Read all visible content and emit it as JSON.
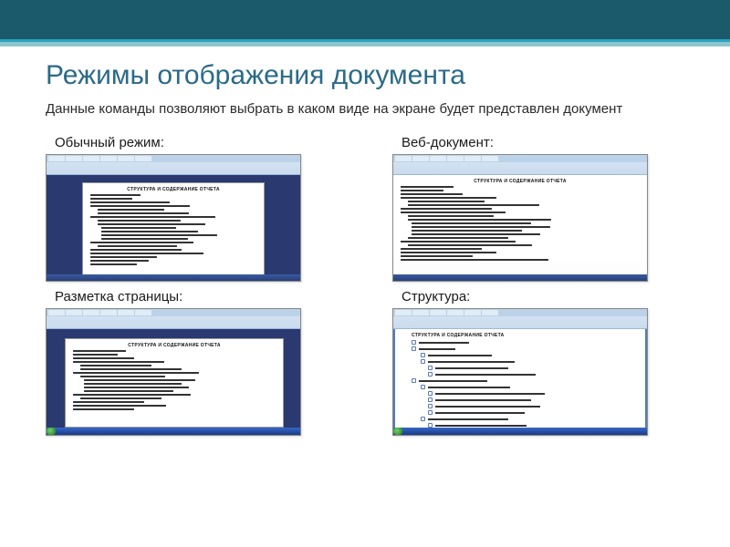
{
  "slide": {
    "title": "Режимы отображения документа",
    "subtitle": "Данные команды позволяют выбрать в каком виде на экране будет представлен документ",
    "doc_heading": "СТРУКТУРА И СОДЕРЖАНИЕ ОТЧЕТА",
    "cells": {
      "normal": {
        "label": "Обычный режим:"
      },
      "web": {
        "label": "Веб-документ:"
      },
      "layout": {
        "label": "Разметка страницы:"
      },
      "outline": {
        "label": "Структура:"
      }
    }
  }
}
